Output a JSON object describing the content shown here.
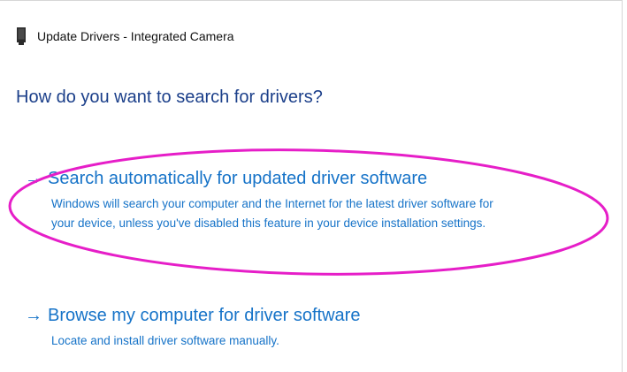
{
  "window": {
    "title": "Update Drivers - Integrated Camera"
  },
  "main": {
    "heading": "How do you want to search for drivers?",
    "options": [
      {
        "title": "Search automatically for updated driver software",
        "description_lines": [
          "Windows will search your computer and the Internet for the latest driver software for",
          "your device, unless you've disabled this feature in your device installation settings."
        ]
      },
      {
        "title": "Browse my computer for driver software",
        "description_lines": [
          "Locate and install driver software manually."
        ]
      }
    ]
  },
  "icons": {
    "title_icon": "device-icon",
    "option_arrow": "arrow-right-icon"
  },
  "colors": {
    "heading": "#1b3f8a",
    "link": "#1673c8",
    "highlight_ellipse": "#e61ec8"
  }
}
